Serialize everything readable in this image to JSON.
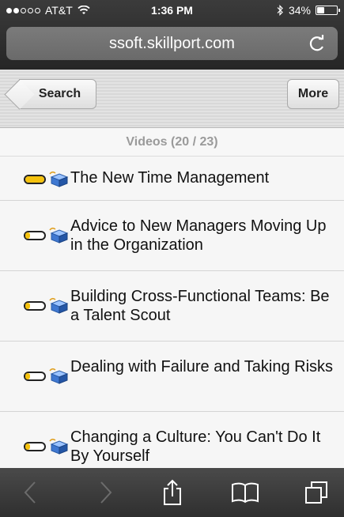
{
  "status_bar": {
    "carrier": "AT&T",
    "time": "1:36 PM",
    "battery_percent": "34%",
    "battery_level": 0.34
  },
  "url_bar": {
    "url": "ssoft.skillport.com",
    "reload_icon": "reload-icon"
  },
  "nav": {
    "back_label": "Search",
    "more_label": "More"
  },
  "list": {
    "header": "Videos (20 / 23)",
    "items": [
      {
        "title": "The New Time Management",
        "progress": 1.0,
        "icon": "video-icon"
      },
      {
        "title": "Advice to New Managers Moving Up in the Organization",
        "progress": 0.25,
        "icon": "video-icon"
      },
      {
        "title": "Building Cross-Functional Teams: Be a Talent Scout",
        "progress": 0.25,
        "icon": "video-icon"
      },
      {
        "title": "Dealing with Failure and Taking Risks",
        "progress": 0.25,
        "icon": "video-icon"
      },
      {
        "title": "Changing a Culture: You Can't Do It By Yourself",
        "progress": 0.25,
        "icon": "video-icon"
      }
    ]
  },
  "toolbar": {
    "icons": [
      "back-icon",
      "forward-icon",
      "share-icon",
      "bookmarks-icon",
      "tabs-icon"
    ]
  },
  "colors": {
    "progress_fill": "#f5c20e",
    "chrome_dark": "#2f2f2f"
  }
}
